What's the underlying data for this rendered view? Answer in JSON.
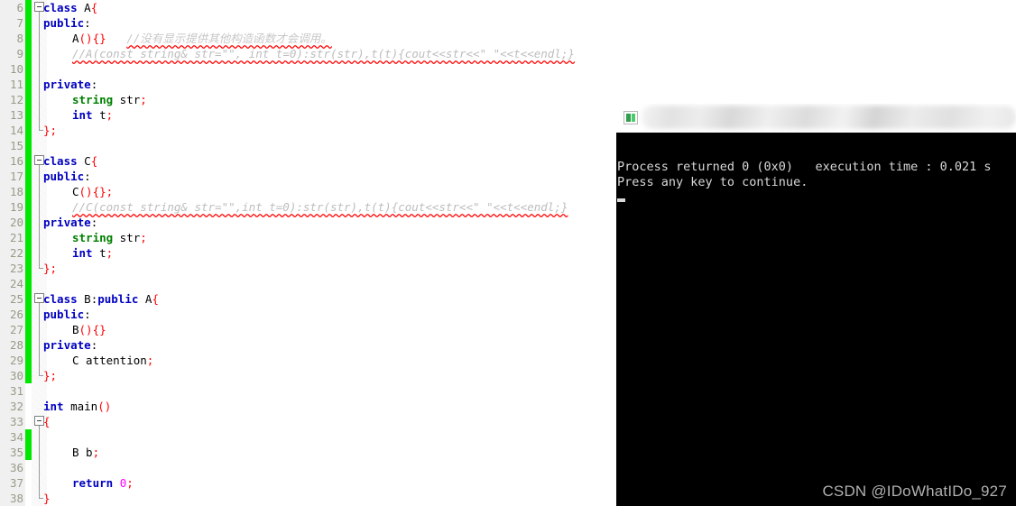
{
  "editor": {
    "first_line_number": 6,
    "change_bar_color": "#00e800",
    "gutter_bg": "#f0f0f0",
    "lines": [
      {
        "n": 6,
        "changed": true,
        "fold": "start",
        "indent": 0,
        "tokens": [
          {
            "t": "class ",
            "c": "kw"
          },
          {
            "t": "A",
            "c": "id"
          },
          {
            "t": "{",
            "c": "pun"
          }
        ]
      },
      {
        "n": 7,
        "changed": true,
        "fold": "line",
        "indent": 0,
        "tokens": [
          {
            "t": "public",
            "c": "kw"
          },
          {
            "t": ":",
            "c": "id"
          }
        ]
      },
      {
        "n": 8,
        "changed": true,
        "fold": "line",
        "indent": 2,
        "tokens": [
          {
            "t": "A",
            "c": "id"
          },
          {
            "t": "()",
            "c": "pun"
          },
          {
            "t": "{}",
            "c": "pun"
          },
          {
            "t": "   ",
            "c": "id"
          },
          {
            "t": "//没有显示提供其他构造函数才会调用。",
            "c": "cmt-cn sq"
          }
        ]
      },
      {
        "n": 9,
        "changed": true,
        "fold": "line",
        "indent": 2,
        "tokens": [
          {
            "t": "//A(const string& str=\"\", int t=0):str(str),t(t){cout<<str<<\" \"<<t<<endl;}",
            "c": "cmt-gray sq"
          }
        ]
      },
      {
        "n": 10,
        "changed": true,
        "fold": "line",
        "indent": 0,
        "tokens": []
      },
      {
        "n": 11,
        "changed": true,
        "fold": "line",
        "indent": 0,
        "tokens": [
          {
            "t": "private",
            "c": "kw"
          },
          {
            "t": ":",
            "c": "id"
          }
        ]
      },
      {
        "n": 12,
        "changed": true,
        "fold": "line",
        "indent": 2,
        "tokens": [
          {
            "t": "string",
            "c": "type"
          },
          {
            "t": " str",
            "c": "id"
          },
          {
            "t": ";",
            "c": "pun"
          }
        ]
      },
      {
        "n": 13,
        "changed": true,
        "fold": "line",
        "indent": 2,
        "tokens": [
          {
            "t": "int",
            "c": "kw"
          },
          {
            "t": " t",
            "c": "id"
          },
          {
            "t": ";",
            "c": "pun"
          }
        ]
      },
      {
        "n": 14,
        "changed": true,
        "fold": "end",
        "indent": 0,
        "tokens": [
          {
            "t": "};",
            "c": "pun"
          }
        ]
      },
      {
        "n": 15,
        "changed": true,
        "fold": "none",
        "indent": 0,
        "tokens": []
      },
      {
        "n": 16,
        "changed": true,
        "fold": "start",
        "indent": 0,
        "tokens": [
          {
            "t": "class ",
            "c": "kw"
          },
          {
            "t": "C",
            "c": "id"
          },
          {
            "t": "{",
            "c": "pun"
          }
        ]
      },
      {
        "n": 17,
        "changed": true,
        "fold": "line",
        "indent": 0,
        "tokens": [
          {
            "t": "public",
            "c": "kw"
          },
          {
            "t": ":",
            "c": "id"
          }
        ]
      },
      {
        "n": 18,
        "changed": true,
        "fold": "line",
        "indent": 2,
        "tokens": [
          {
            "t": "C",
            "c": "id"
          },
          {
            "t": "()",
            "c": "pun"
          },
          {
            "t": "{}",
            "c": "pun"
          },
          {
            "t": ";",
            "c": "pun"
          }
        ]
      },
      {
        "n": 19,
        "changed": true,
        "fold": "line",
        "indent": 2,
        "tokens": [
          {
            "t": "//C(const string& str=\"\",int t=0):str(str),t(t){cout<<str<<\" \"<<t<<endl;}",
            "c": "cmt-gray sq"
          }
        ]
      },
      {
        "n": 20,
        "changed": true,
        "fold": "line",
        "indent": 0,
        "tokens": [
          {
            "t": "private",
            "c": "kw"
          },
          {
            "t": ":",
            "c": "id"
          }
        ]
      },
      {
        "n": 21,
        "changed": true,
        "fold": "line",
        "indent": 2,
        "tokens": [
          {
            "t": "string",
            "c": "type"
          },
          {
            "t": " str",
            "c": "id"
          },
          {
            "t": ";",
            "c": "pun"
          }
        ]
      },
      {
        "n": 22,
        "changed": true,
        "fold": "line",
        "indent": 2,
        "tokens": [
          {
            "t": "int",
            "c": "kw"
          },
          {
            "t": " t",
            "c": "id"
          },
          {
            "t": ";",
            "c": "pun"
          }
        ]
      },
      {
        "n": 23,
        "changed": true,
        "fold": "end",
        "indent": 0,
        "tokens": [
          {
            "t": "};",
            "c": "pun"
          }
        ]
      },
      {
        "n": 24,
        "changed": true,
        "fold": "none",
        "indent": 0,
        "tokens": []
      },
      {
        "n": 25,
        "changed": true,
        "fold": "start",
        "indent": 0,
        "tokens": [
          {
            "t": "class ",
            "c": "kw"
          },
          {
            "t": "B",
            "c": "id"
          },
          {
            "t": ":",
            "c": "id"
          },
          {
            "t": "public ",
            "c": "kw"
          },
          {
            "t": "A",
            "c": "id"
          },
          {
            "t": "{",
            "c": "pun"
          }
        ]
      },
      {
        "n": 26,
        "changed": true,
        "fold": "line",
        "indent": 0,
        "tokens": [
          {
            "t": "public",
            "c": "kw"
          },
          {
            "t": ":",
            "c": "id"
          }
        ]
      },
      {
        "n": 27,
        "changed": true,
        "fold": "line",
        "indent": 2,
        "tokens": [
          {
            "t": "B",
            "c": "id"
          },
          {
            "t": "()",
            "c": "pun"
          },
          {
            "t": "{}",
            "c": "pun"
          }
        ]
      },
      {
        "n": 28,
        "changed": true,
        "fold": "line",
        "indent": 0,
        "tokens": [
          {
            "t": "private",
            "c": "kw"
          },
          {
            "t": ":",
            "c": "id"
          }
        ]
      },
      {
        "n": 29,
        "changed": true,
        "fold": "line",
        "indent": 2,
        "tokens": [
          {
            "t": "C attention",
            "c": "id"
          },
          {
            "t": ";",
            "c": "pun"
          }
        ]
      },
      {
        "n": 30,
        "changed": true,
        "fold": "end",
        "indent": 0,
        "tokens": [
          {
            "t": "};",
            "c": "pun"
          }
        ]
      },
      {
        "n": 31,
        "changed": false,
        "fold": "none",
        "indent": 0,
        "tokens": []
      },
      {
        "n": 32,
        "changed": false,
        "fold": "none",
        "indent": 0,
        "tokens": [
          {
            "t": "int ",
            "c": "kw"
          },
          {
            "t": "main",
            "c": "id"
          },
          {
            "t": "()",
            "c": "pun"
          }
        ]
      },
      {
        "n": 33,
        "changed": false,
        "fold": "start",
        "indent": 0,
        "tokens": [
          {
            "t": "{",
            "c": "pun"
          }
        ]
      },
      {
        "n": 34,
        "changed": true,
        "fold": "line",
        "indent": 0,
        "tokens": []
      },
      {
        "n": 35,
        "changed": true,
        "fold": "line",
        "indent": 2,
        "tokens": [
          {
            "t": "B b",
            "c": "id"
          },
          {
            "t": ";",
            "c": "pun"
          }
        ]
      },
      {
        "n": 36,
        "changed": false,
        "fold": "line",
        "indent": 0,
        "tokens": []
      },
      {
        "n": 37,
        "changed": false,
        "fold": "line",
        "indent": 2,
        "tokens": [
          {
            "t": "return ",
            "c": "kw"
          },
          {
            "t": "0",
            "c": "num"
          },
          {
            "t": ";",
            "c": "pun"
          }
        ]
      },
      {
        "n": 38,
        "changed": false,
        "fold": "end",
        "indent": 0,
        "tokens": [
          {
            "t": "}",
            "c": "pun"
          }
        ]
      }
    ]
  },
  "console": {
    "title": "",
    "icon": "console-app-icon",
    "lines": [
      "Process returned 0 (0x0)   execution time : 0.021 s",
      "Press any key to continue."
    ],
    "cursor_visible": true
  },
  "watermark": {
    "text": "CSDN @IDoWhatIDo_927"
  }
}
